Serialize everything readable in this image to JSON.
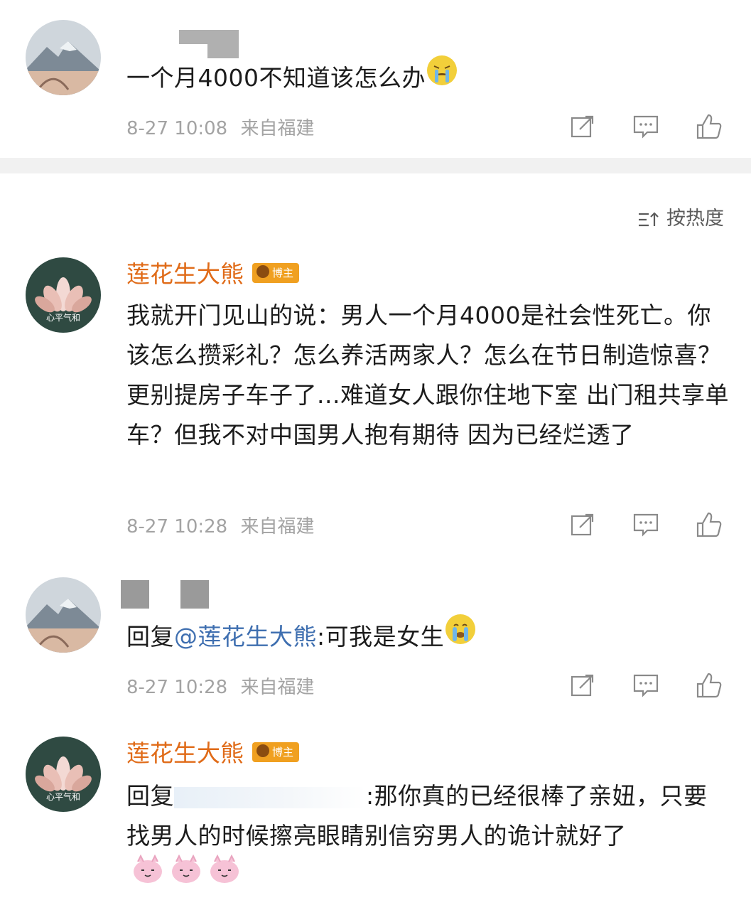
{
  "posts": [
    {
      "text": "一个月4000不知道该怎么办",
      "time": "8-27 10:08",
      "location": "来自福建"
    }
  ],
  "sort_label": "按热度",
  "comments": [
    {
      "name": "莲花生大熊",
      "badge": "博主",
      "avatar_caption": "心平气和",
      "text": "我就开门见山的说：男人一个月4000是社会性死亡。你该怎么攒彩礼？怎么养活两家人？怎么在节日制造惊喜？更别提房子车子了...难道女人跟你住地下室 出门租共享单车？但我不对中国男人抱有期待 因为已经烂透了",
      "time": "8-27 10:28",
      "location": "来自福建"
    },
    {
      "reply_prefix": "回复",
      "mention": "@莲花生大熊",
      "text": ":可我是女生",
      "time": "8-27 10:28",
      "location": "来自福建"
    },
    {
      "name": "莲花生大熊",
      "badge": "博主",
      "avatar_caption": "心平气和",
      "reply_prefix": "回复",
      "text": ":那你真的已经很棒了亲妞，只要找男人的时候擦亮眼睛别信穷男人的诡计就好了"
    }
  ],
  "colors": {
    "username": "#e06b18",
    "mention": "#3f6fb0",
    "meta": "#a3a3a3",
    "badge": "#f0a020"
  },
  "icons": [
    "share-icon",
    "comment-icon",
    "like-icon",
    "sort-icon",
    "crying-emoji",
    "pig-emoji"
  ]
}
